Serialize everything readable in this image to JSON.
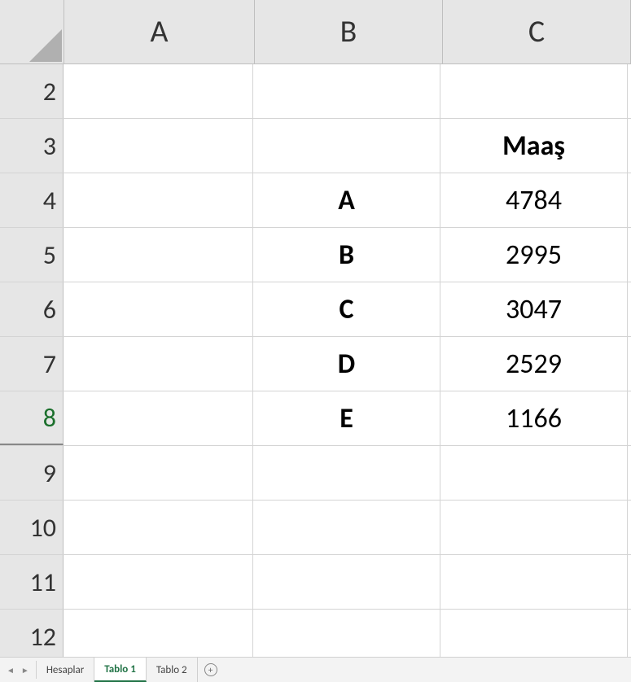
{
  "columns": [
    "A",
    "B",
    "C"
  ],
  "rows": [
    "2",
    "3",
    "4",
    "5",
    "6",
    "7",
    "8",
    "9",
    "10",
    "11",
    "12"
  ],
  "cells": {
    "C3": "Maaş",
    "B4": "A",
    "C4": "4784",
    "B5": "B",
    "C5": "2995",
    "B6": "C",
    "C6": "3047",
    "B7": "D",
    "C7": "2529",
    "B8": "E",
    "C8": "1166"
  },
  "tabs": {
    "nav_prev": "◄",
    "nav_next": "►",
    "items": [
      "Hesaplar",
      "Tablo 1",
      "Tablo 2"
    ],
    "active": "Tablo 1",
    "add": "+"
  },
  "chart_data": {
    "type": "table",
    "title": "Maaş",
    "categories": [
      "A",
      "B",
      "C",
      "D",
      "E"
    ],
    "values": [
      4784,
      2995,
      3047,
      2529,
      1166
    ]
  }
}
